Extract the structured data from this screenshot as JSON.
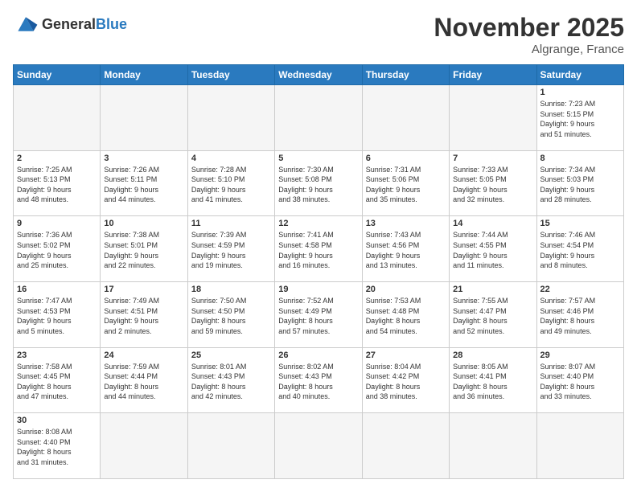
{
  "header": {
    "logo_general": "General",
    "logo_blue": "Blue",
    "title": "November 2025",
    "location": "Algrange, France"
  },
  "days_of_week": [
    "Sunday",
    "Monday",
    "Tuesday",
    "Wednesday",
    "Thursday",
    "Friday",
    "Saturday"
  ],
  "weeks": [
    [
      {
        "num": "",
        "info": ""
      },
      {
        "num": "",
        "info": ""
      },
      {
        "num": "",
        "info": ""
      },
      {
        "num": "",
        "info": ""
      },
      {
        "num": "",
        "info": ""
      },
      {
        "num": "",
        "info": ""
      },
      {
        "num": "1",
        "info": "Sunrise: 7:23 AM\nSunset: 5:15 PM\nDaylight: 9 hours\nand 51 minutes."
      }
    ],
    [
      {
        "num": "2",
        "info": "Sunrise: 7:25 AM\nSunset: 5:13 PM\nDaylight: 9 hours\nand 48 minutes."
      },
      {
        "num": "3",
        "info": "Sunrise: 7:26 AM\nSunset: 5:11 PM\nDaylight: 9 hours\nand 44 minutes."
      },
      {
        "num": "4",
        "info": "Sunrise: 7:28 AM\nSunset: 5:10 PM\nDaylight: 9 hours\nand 41 minutes."
      },
      {
        "num": "5",
        "info": "Sunrise: 7:30 AM\nSunset: 5:08 PM\nDaylight: 9 hours\nand 38 minutes."
      },
      {
        "num": "6",
        "info": "Sunrise: 7:31 AM\nSunset: 5:06 PM\nDaylight: 9 hours\nand 35 minutes."
      },
      {
        "num": "7",
        "info": "Sunrise: 7:33 AM\nSunset: 5:05 PM\nDaylight: 9 hours\nand 32 minutes."
      },
      {
        "num": "8",
        "info": "Sunrise: 7:34 AM\nSunset: 5:03 PM\nDaylight: 9 hours\nand 28 minutes."
      }
    ],
    [
      {
        "num": "9",
        "info": "Sunrise: 7:36 AM\nSunset: 5:02 PM\nDaylight: 9 hours\nand 25 minutes."
      },
      {
        "num": "10",
        "info": "Sunrise: 7:38 AM\nSunset: 5:01 PM\nDaylight: 9 hours\nand 22 minutes."
      },
      {
        "num": "11",
        "info": "Sunrise: 7:39 AM\nSunset: 4:59 PM\nDaylight: 9 hours\nand 19 minutes."
      },
      {
        "num": "12",
        "info": "Sunrise: 7:41 AM\nSunset: 4:58 PM\nDaylight: 9 hours\nand 16 minutes."
      },
      {
        "num": "13",
        "info": "Sunrise: 7:43 AM\nSunset: 4:56 PM\nDaylight: 9 hours\nand 13 minutes."
      },
      {
        "num": "14",
        "info": "Sunrise: 7:44 AM\nSunset: 4:55 PM\nDaylight: 9 hours\nand 11 minutes."
      },
      {
        "num": "15",
        "info": "Sunrise: 7:46 AM\nSunset: 4:54 PM\nDaylight: 9 hours\nand 8 minutes."
      }
    ],
    [
      {
        "num": "16",
        "info": "Sunrise: 7:47 AM\nSunset: 4:53 PM\nDaylight: 9 hours\nand 5 minutes."
      },
      {
        "num": "17",
        "info": "Sunrise: 7:49 AM\nSunset: 4:51 PM\nDaylight: 9 hours\nand 2 minutes."
      },
      {
        "num": "18",
        "info": "Sunrise: 7:50 AM\nSunset: 4:50 PM\nDaylight: 8 hours\nand 59 minutes."
      },
      {
        "num": "19",
        "info": "Sunrise: 7:52 AM\nSunset: 4:49 PM\nDaylight: 8 hours\nand 57 minutes."
      },
      {
        "num": "20",
        "info": "Sunrise: 7:53 AM\nSunset: 4:48 PM\nDaylight: 8 hours\nand 54 minutes."
      },
      {
        "num": "21",
        "info": "Sunrise: 7:55 AM\nSunset: 4:47 PM\nDaylight: 8 hours\nand 52 minutes."
      },
      {
        "num": "22",
        "info": "Sunrise: 7:57 AM\nSunset: 4:46 PM\nDaylight: 8 hours\nand 49 minutes."
      }
    ],
    [
      {
        "num": "23",
        "info": "Sunrise: 7:58 AM\nSunset: 4:45 PM\nDaylight: 8 hours\nand 47 minutes."
      },
      {
        "num": "24",
        "info": "Sunrise: 7:59 AM\nSunset: 4:44 PM\nDaylight: 8 hours\nand 44 minutes."
      },
      {
        "num": "25",
        "info": "Sunrise: 8:01 AM\nSunset: 4:43 PM\nDaylight: 8 hours\nand 42 minutes."
      },
      {
        "num": "26",
        "info": "Sunrise: 8:02 AM\nSunset: 4:43 PM\nDaylight: 8 hours\nand 40 minutes."
      },
      {
        "num": "27",
        "info": "Sunrise: 8:04 AM\nSunset: 4:42 PM\nDaylight: 8 hours\nand 38 minutes."
      },
      {
        "num": "28",
        "info": "Sunrise: 8:05 AM\nSunset: 4:41 PM\nDaylight: 8 hours\nand 36 minutes."
      },
      {
        "num": "29",
        "info": "Sunrise: 8:07 AM\nSunset: 4:40 PM\nDaylight: 8 hours\nand 33 minutes."
      }
    ],
    [
      {
        "num": "30",
        "info": "Sunrise: 8:08 AM\nSunset: 4:40 PM\nDaylight: 8 hours\nand 31 minutes."
      },
      {
        "num": "",
        "info": ""
      },
      {
        "num": "",
        "info": ""
      },
      {
        "num": "",
        "info": ""
      },
      {
        "num": "",
        "info": ""
      },
      {
        "num": "",
        "info": ""
      },
      {
        "num": "",
        "info": ""
      }
    ]
  ]
}
